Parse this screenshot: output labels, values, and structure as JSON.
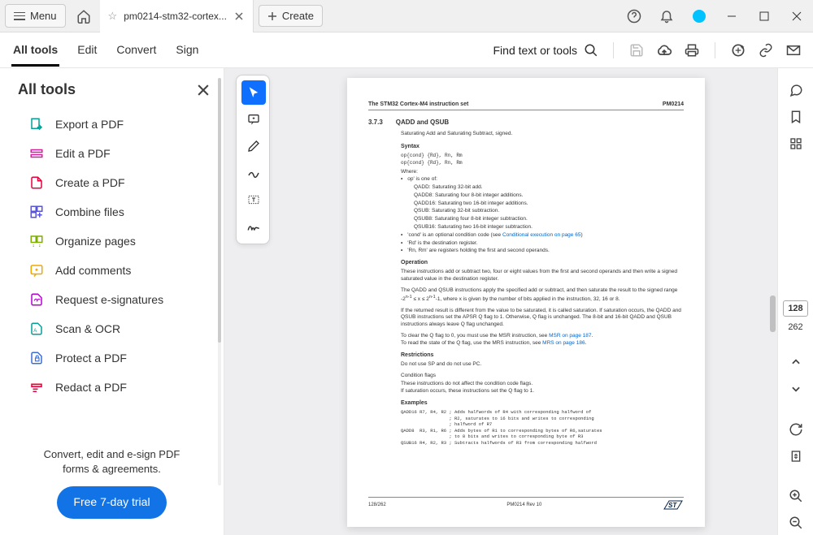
{
  "titlebar": {
    "menu": "Menu",
    "tab_name": "pm0214-stm32-cortex...",
    "create": "Create"
  },
  "secbar": {
    "items": [
      "All tools",
      "Edit",
      "Convert",
      "Sign"
    ],
    "find": "Find text or tools"
  },
  "leftpane": {
    "title": "All tools",
    "tools": [
      {
        "label": "Export a PDF",
        "color": "#00a29a"
      },
      {
        "label": "Edit a PDF",
        "color": "#d61f9c"
      },
      {
        "label": "Create a PDF",
        "color": "#e8003a"
      },
      {
        "label": "Combine files",
        "color": "#5856d6"
      },
      {
        "label": "Organize pages",
        "color": "#7cad00"
      },
      {
        "label": "Add comments",
        "color": "#f0a800"
      },
      {
        "label": "Request e-signatures",
        "color": "#b800d6"
      },
      {
        "label": "Scan & OCR",
        "color": "#00a29a"
      },
      {
        "label": "Protect a PDF",
        "color": "#3a6fd8"
      },
      {
        "label": "Redact a PDF",
        "color": "#e8003a"
      }
    ],
    "footer_line1": "Convert, edit and e-sign PDF",
    "footer_line2": "forms & agreements.",
    "trial": "Free 7-day trial"
  },
  "rail": {
    "cur_page": "128",
    "total_pages": "262"
  },
  "doc": {
    "header_left": "The STM32 Cortex-M4 instruction set",
    "header_right": "PM0214",
    "secnum": "3.7.3",
    "sectitle": "QADD and QSUB",
    "desc": "Saturating Add and Saturating Subtract, signed.",
    "syntax_h": "Syntax",
    "syntax_code": "op{cond} {Rd}, Rn, Rm\nop{cond} {Rd}, Rn, Rm",
    "where": "Where:",
    "op_is": "op' is one of:",
    "ops": [
      "QADD: Saturating 32-bit add.",
      "QADD8: Saturating four 8-bit integer additions.",
      "QADD16: Saturating two 16-bit integer additions.",
      "QSUB: Saturating 32-bit subtraction.",
      "QSUB8: Saturating four 8-bit integer subtraction.",
      "QSUB16: Saturating two 16-bit integer subtraction."
    ],
    "cond": "'cond' is an optional condition code (see ",
    "cond_link": "Conditional execution on page 65",
    "cond_end": ")",
    "rd": "'Rd' is the destination register.",
    "rnrm": "'Rn, Rm' are registers holding the first and second operands.",
    "op_h": "Operation",
    "op_p1": "These instructions add or subtract two, four or eight values from the first and second operands and then write a signed saturated value in the destination register.",
    "op_p2a": "The QADD and QSUB instructions apply the specified add or subtract, and then saturate the result to the signed range -2",
    "op_p2b": " ≤ x ≤ 2",
    "op_p2c": "-1, where x is given by the number of bits applied in the instruction, 32, 16 or 8.",
    "op_p3": "If the returned result is different from the value to be saturated, it is called saturation. If saturation occurs, the QADD and QSUB instructions set the APSR Q flag to 1. Otherwise, Q flag is unchanged. The 8-bit and 16-bit QADD and QSUB instructions always leave Q flag unchanged.",
    "op_p4a": "To clear the Q flag to 0, you must use the MSR instruction, see ",
    "op_p4_link": "MSR on page 187",
    "op_p4b": ".",
    "op_p5a": "To read the state of the Q flag, use the MRS instruction, see ",
    "op_p5_link": "MRS on page 186",
    "op_p5b": ".",
    "rest_h": "Restrictions",
    "rest_p": "Do not use SP and do not use PC.",
    "cond_flags": "Condition flags",
    "cond_p1": "These instructions do not affect the condition code flags.",
    "cond_p2": "If saturation occurs, these instructions set the Q flag to 1.",
    "ex_h": "Examples",
    "ex_code": "QADD16 R7, R4, R2 ; Adds halfwords of R4 with corresponding halfword of\n                  ; R2, saturates to 16 bits and writes to corresponding\n                  ; halfword of R7\nQADD8  R3, R1, R6 ; Adds bytes of R1 to corresponding bytes of R6,saturates\n                  ; to 8 bits and writes to corresponding byte of R3\nQSUB16 R4, R2, R3 ; Subtracts halfwords of R3 from corresponding halfword",
    "foot_left": "128/262",
    "foot_mid": "PM0214 Rev 10"
  }
}
